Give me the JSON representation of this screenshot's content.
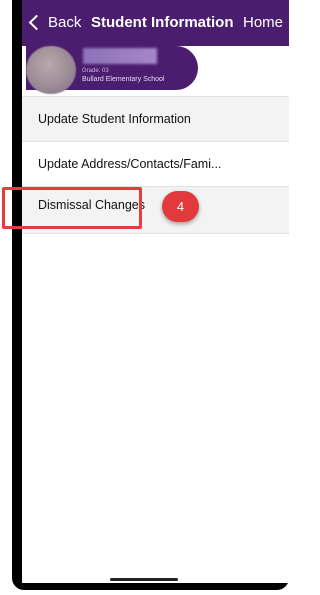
{
  "nav": {
    "back_label": "Back",
    "title": "Student Information",
    "home_label": "Home"
  },
  "student": {
    "grade": "Grade: 03",
    "school": "Bullard Elementary School"
  },
  "menu": {
    "items": [
      {
        "label": "Update Student Information"
      },
      {
        "label": "Update Address/Contacts/Fami..."
      },
      {
        "label": "Dismissal Changes"
      }
    ]
  },
  "annotation": {
    "step_number": "4"
  },
  "colors": {
    "brand_purple": "#4a1d6e",
    "highlight_red": "#e53c3f",
    "badge_red": "#e23a3c"
  }
}
